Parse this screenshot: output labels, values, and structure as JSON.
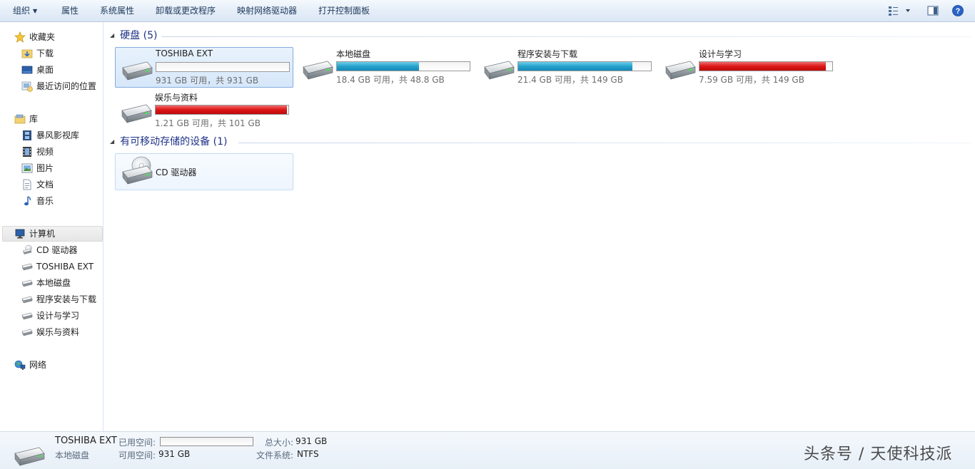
{
  "toolbar": {
    "organize": "组织",
    "properties": "属性",
    "system_properties": "系统属性",
    "uninstall": "卸载或更改程序",
    "map_drive": "映射网络驱动器",
    "control_panel": "打开控制面板",
    "icons": [
      "view-options-icon",
      "preview-pane-icon",
      "help-icon"
    ]
  },
  "nav": {
    "favorites": {
      "label": "收藏夹",
      "items": [
        "下载",
        "桌面",
        "最近访问的位置"
      ]
    },
    "libraries": {
      "label": "库",
      "items": [
        "暴风影视库",
        "视频",
        "图片",
        "文档",
        "音乐"
      ]
    },
    "computer": {
      "label": "计算机",
      "items": [
        "CD 驱动器",
        "TOSHIBA EXT",
        "本地磁盘",
        "程序安装与下载",
        "设计与学习",
        "娱乐与资料"
      ]
    },
    "network": {
      "label": "网络"
    }
  },
  "groups": {
    "hard_disks": {
      "title": "硬盘 (5)",
      "drives": [
        {
          "name": "TOSHIBA EXT",
          "info": "931 GB 可用，共 931 GB",
          "used_fraction": 0.0,
          "color": "blue"
        },
        {
          "name": "本地磁盘",
          "info": "18.4 GB 可用，共 48.8 GB",
          "used_fraction": 0.62,
          "color": "blue"
        },
        {
          "name": "程序安装与下载",
          "info": "21.4 GB 可用，共 149 GB",
          "used_fraction": 0.86,
          "color": "blue"
        },
        {
          "name": "设计与学习",
          "info": "7.59 GB 可用，共 149 GB",
          "used_fraction": 0.95,
          "color": "red"
        },
        {
          "name": "娱乐与资料",
          "info": "1.21 GB 可用，共 101 GB",
          "used_fraction": 0.99,
          "color": "red"
        }
      ]
    },
    "removable": {
      "title": "有可移动存储的设备 (1)",
      "drives": [
        {
          "name": "CD 驱动器"
        }
      ]
    }
  },
  "details": {
    "name": "TOSHIBA EXT",
    "type": "本地磁盘",
    "used_label": "已用空间:",
    "free_label": "可用空间:",
    "free_value": "931 GB",
    "total_label": "总大小:",
    "total_value": "931 GB",
    "fs_label": "文件系统:",
    "fs_value": "NTFS",
    "used_fraction": 0.0
  },
  "watermark": "头条号 / 天使科技派",
  "colors": {
    "accent": "#1e3287",
    "selection": "#d6e7fa",
    "bar_blue": "#25a2cd",
    "bar_red": "#db1616"
  }
}
